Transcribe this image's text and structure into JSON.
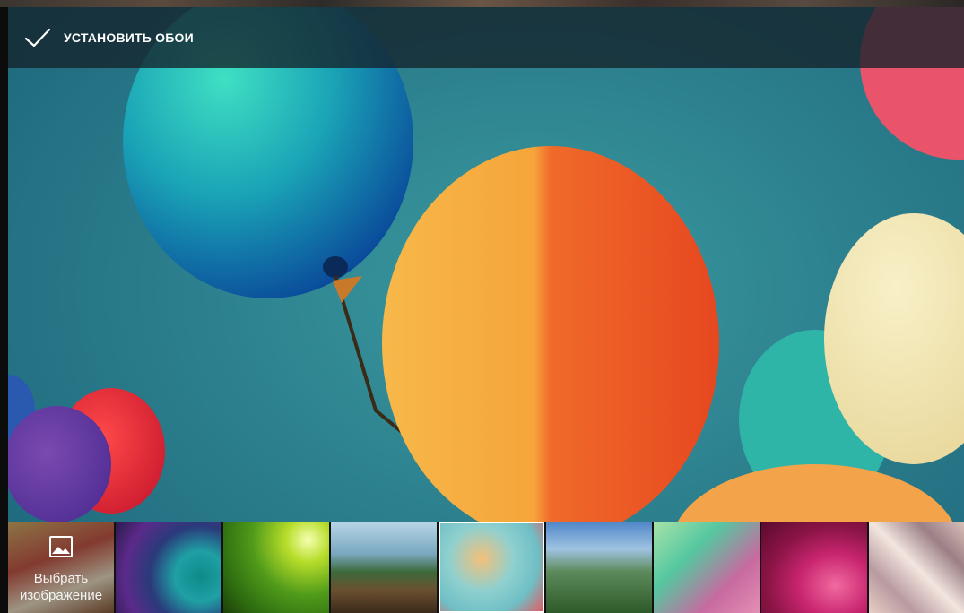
{
  "action_bar": {
    "set_wallpaper_label": "УСТАНОВИТЬ ОБОИ",
    "check_icon": "checkmark-icon"
  },
  "thumbnails": {
    "pick_image_label": "Выбрать изображение",
    "pick_image_icon": "image-icon",
    "selected_index": 5,
    "items": [
      "pick-image",
      "wallpaper-teal-curves",
      "wallpaper-green-leaves",
      "wallpaper-field",
      "wallpaper-balloons",
      "wallpaper-mountains",
      "wallpaper-pastel-blur",
      "wallpaper-pink-swirl",
      "wallpaper-geometric"
    ]
  },
  "colors": {
    "action_bar_bg": "#14232a",
    "selection_border": "#ffffff"
  }
}
